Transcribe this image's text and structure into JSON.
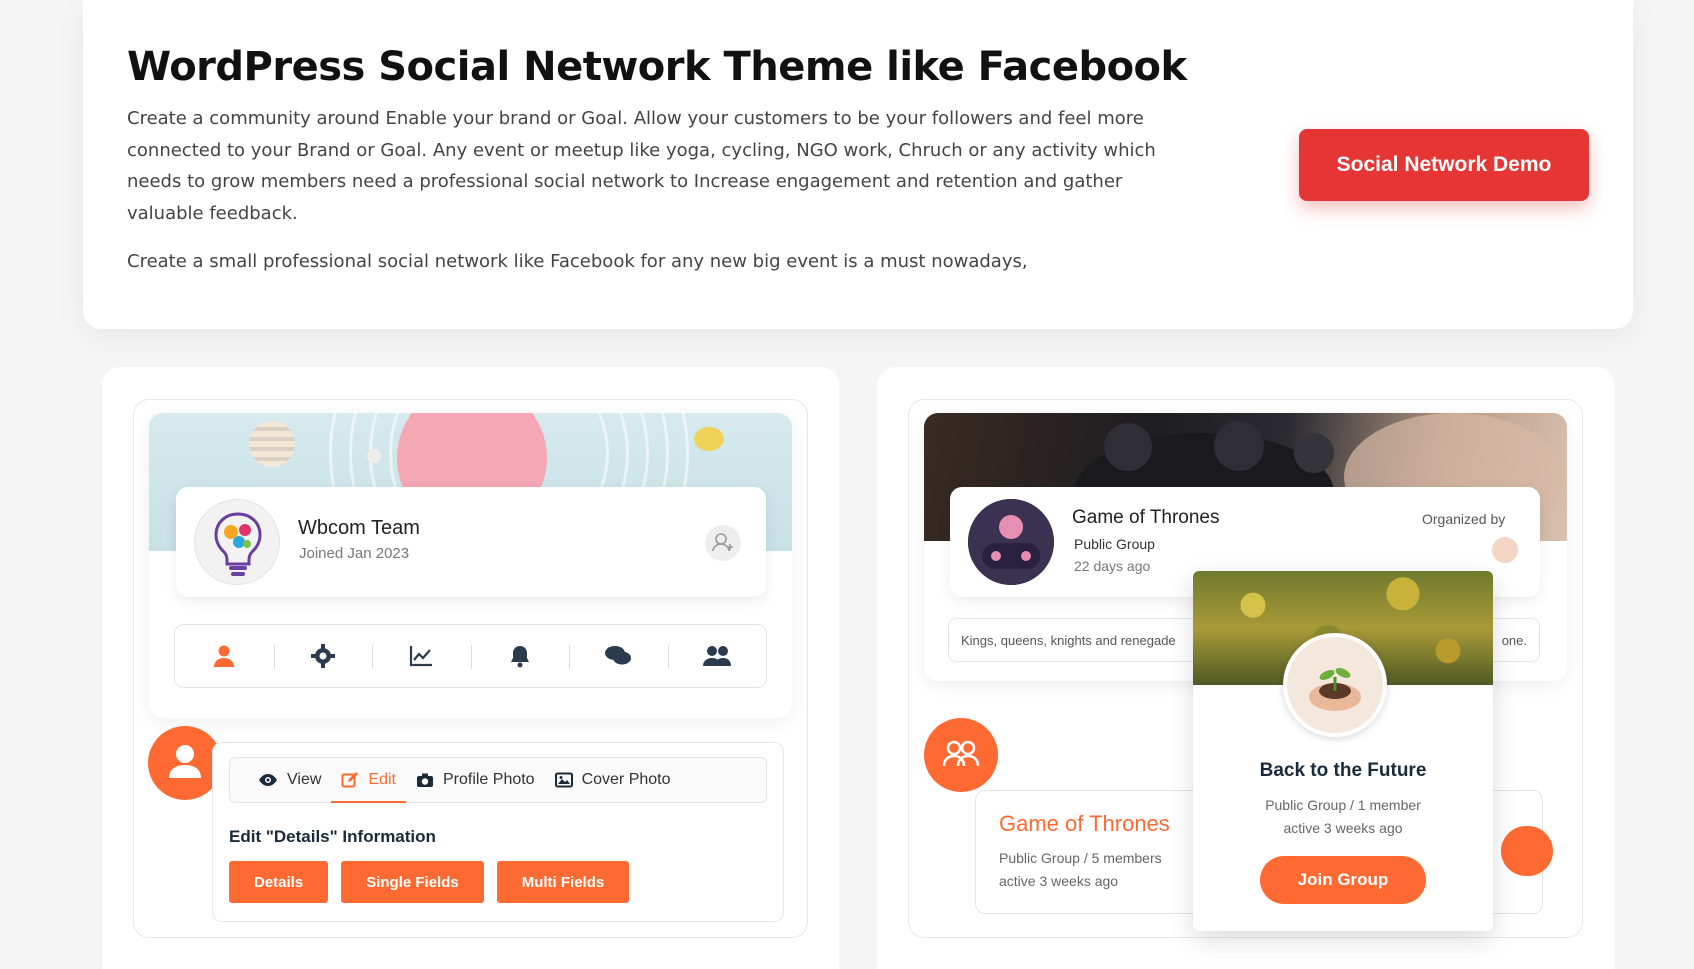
{
  "hero": {
    "title": "WordPress Social Network Theme like Facebook",
    "paragraph1": "Create a community around Enable your brand or Goal. Allow your customers to be your followers and feel more connected to your Brand or Goal. Any event or meetup like yoga, cycling, NGO work, Chruch or any activity which needs to grow members need a professional social network to Increase engagement and retention and gather valuable feedback.",
    "paragraph2": "Create a small professional social network like Facebook for any new big event is a must nowadays,",
    "demo_button": "Social Network Demo"
  },
  "profile_mock": {
    "name": "Wbcom Team",
    "joined": "Joined Jan 2023",
    "icon_bar": [
      "user-icon",
      "gear-icon",
      "chart-icon",
      "bell-icon",
      "comments-icon",
      "users-icon"
    ],
    "edit_tabs": [
      {
        "label": "View",
        "icon": "eye-icon"
      },
      {
        "label": "Edit",
        "icon": "edit-icon"
      },
      {
        "label": "Profile Photo",
        "icon": "camera-icon"
      },
      {
        "label": "Cover Photo",
        "icon": "image-icon"
      }
    ],
    "active_tab": "Edit",
    "edit_heading": "Edit \"Details\" Information",
    "pills": [
      "Details",
      "Single Fields",
      "Multi Fields"
    ]
  },
  "group_mock": {
    "title": "Game of Thrones",
    "type": "Public Group",
    "age": "22 days ago",
    "organized_by": "Organized by",
    "desc_start": "Kings, queens, knights and renegade",
    "desc_end": "one.",
    "list_title": "Game of Thrones",
    "list_type": "Public Group / 5 members",
    "list_active": "active 3 weeks ago",
    "popup": {
      "title": "Back to the Future",
      "type": "Public Group / 1 member",
      "active": "active 3 weeks ago",
      "join": "Join Group"
    }
  },
  "colors": {
    "accent_red": "#e63535",
    "accent_orange": "#ff6a33"
  }
}
